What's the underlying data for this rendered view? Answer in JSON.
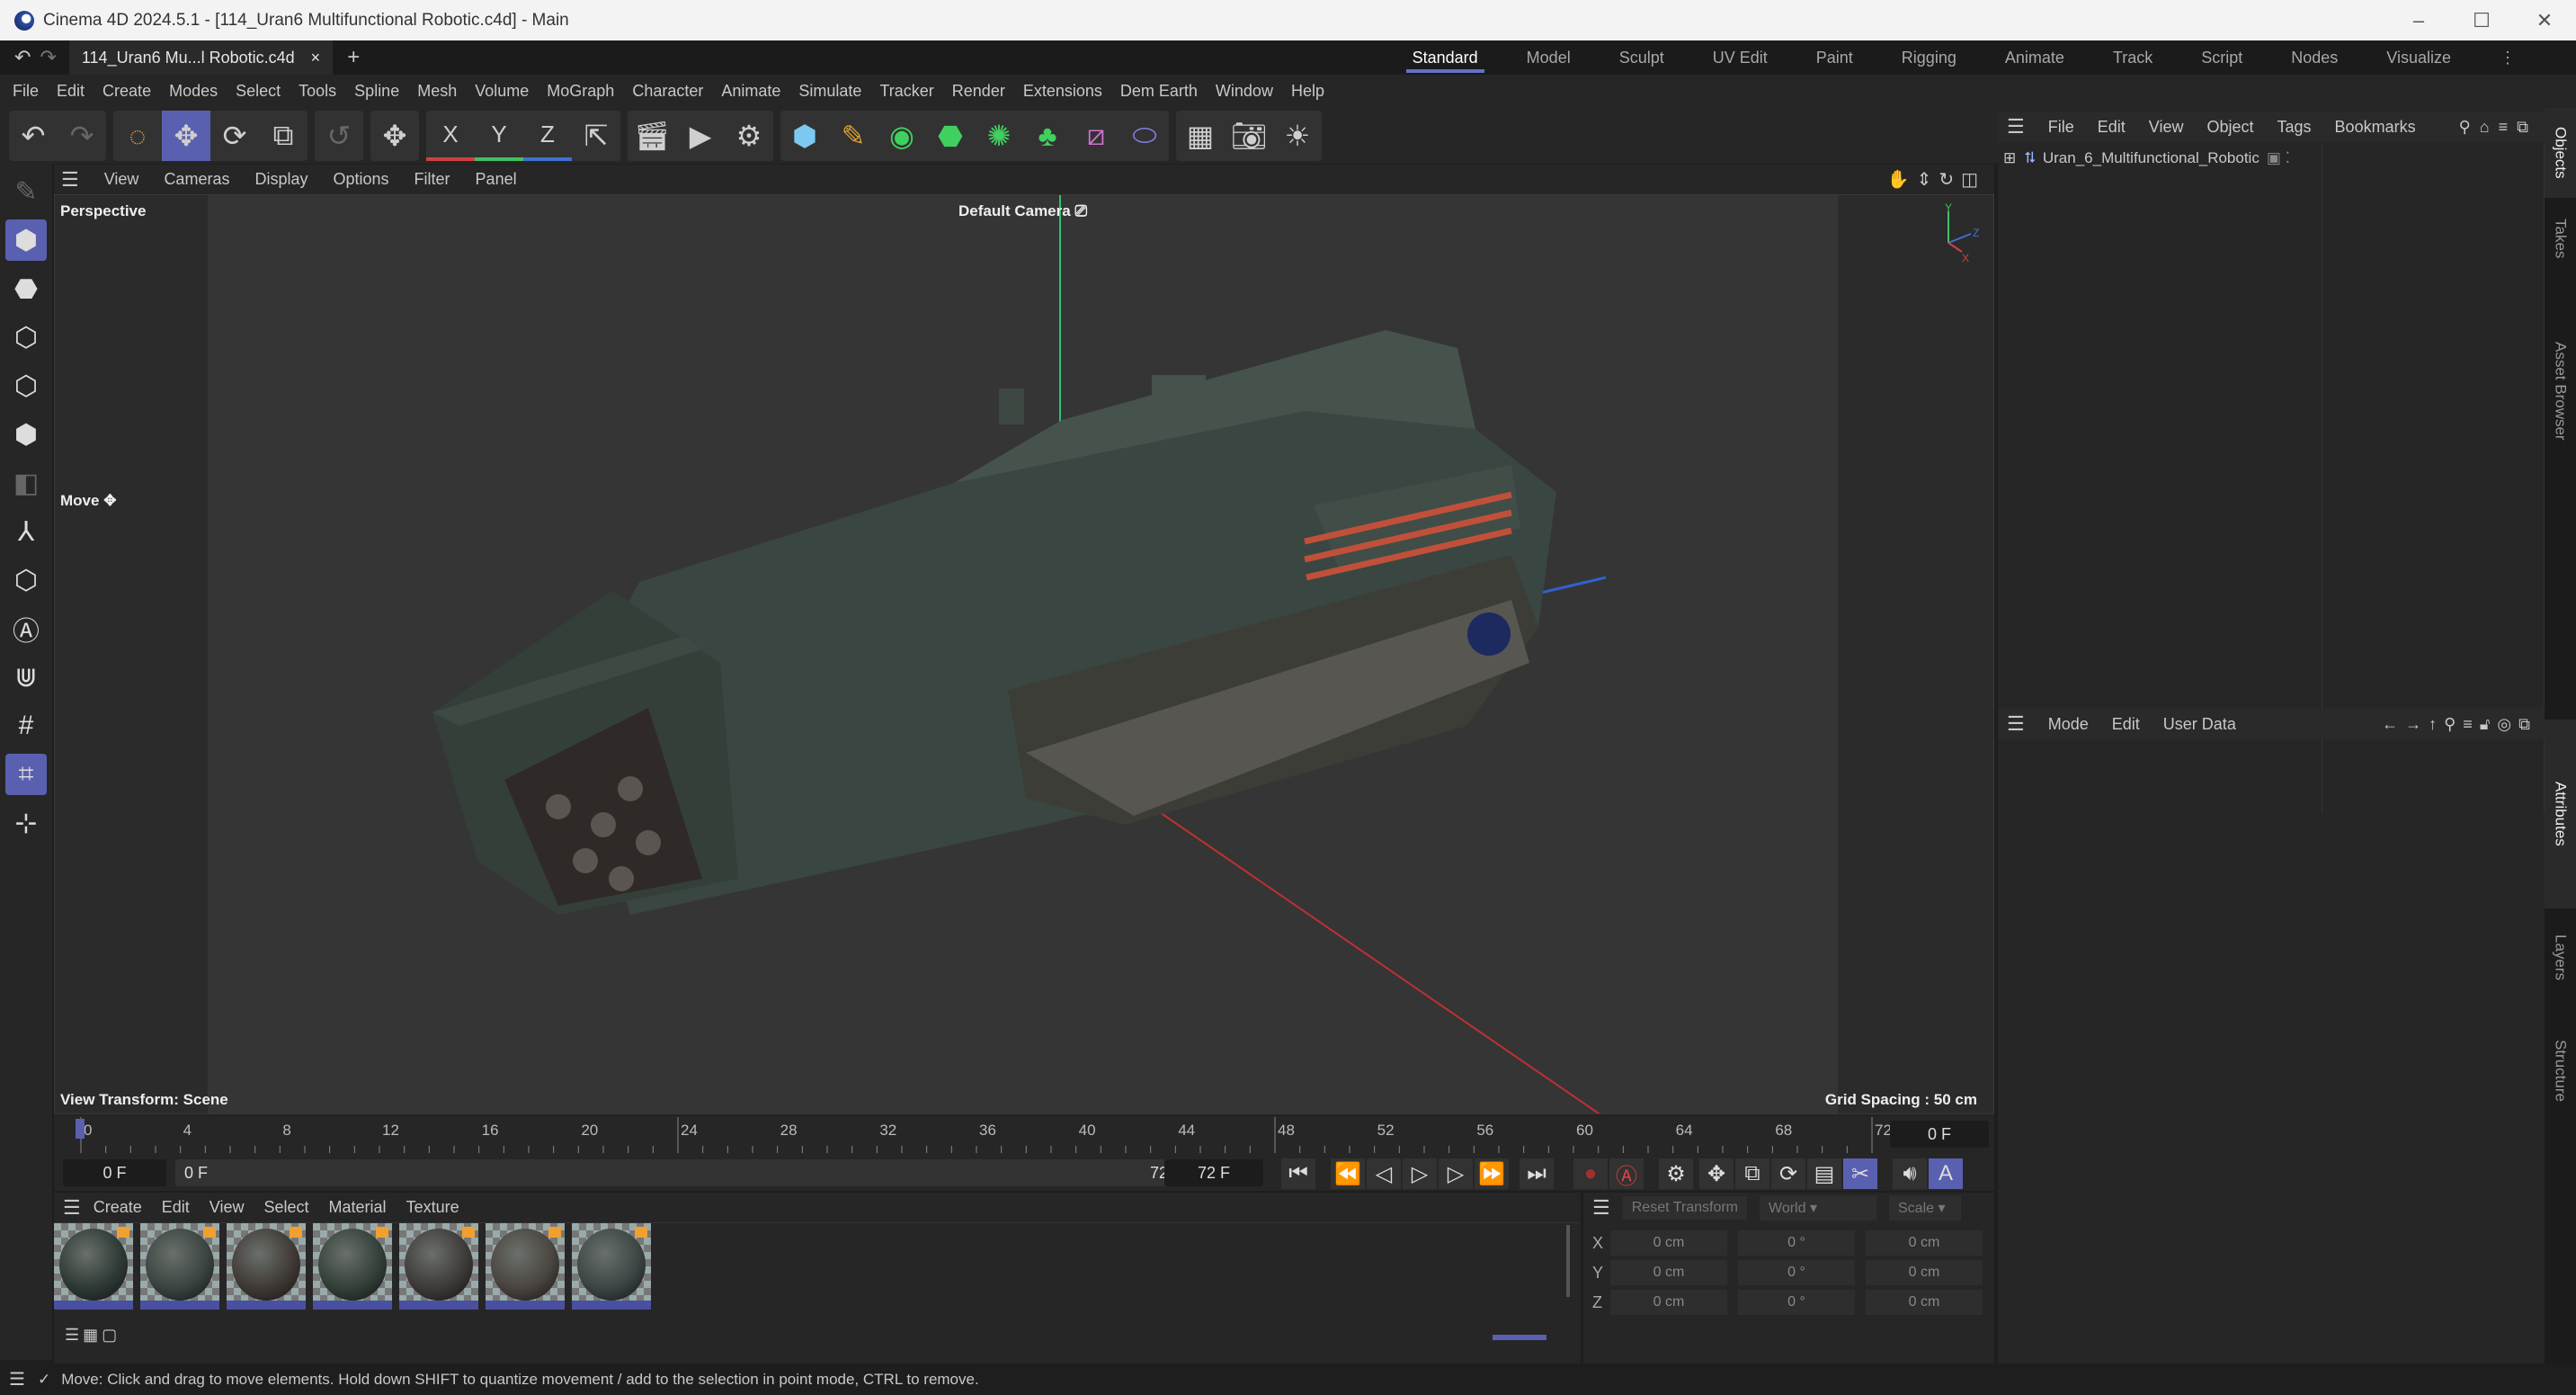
{
  "window": {
    "title": "Cinema 4D 2024.5.1 - [114_Uran6 Multifunctional Robotic.c4d] - Main",
    "minimize": "–",
    "maximize": "☐",
    "close": "✕"
  },
  "tabs": {
    "doc_tab": "114_Uran6 Mu...l Robotic.c4d",
    "close": "×",
    "add": "+",
    "undo": "↶",
    "redo": "↷"
  },
  "layouts": [
    "Standard",
    "Model",
    "Sculpt",
    "UV Edit",
    "Paint",
    "Rigging",
    "Animate",
    "Track",
    "Script",
    "Nodes",
    "Visualize"
  ],
  "layouts_more": "⋮",
  "menu": [
    "File",
    "Edit",
    "Create",
    "Modes",
    "Select",
    "Tools",
    "Spline",
    "Mesh",
    "Volume",
    "MoGraph",
    "Character",
    "Animate",
    "Simulate",
    "Tracker",
    "Render",
    "Extensions",
    "Dem Earth",
    "Window",
    "Help"
  ],
  "toolbar": {
    "x": "X",
    "y": "Y",
    "z": "Z"
  },
  "viewport": {
    "menu": [
      "View",
      "Cameras",
      "Display",
      "Options",
      "Filter",
      "Panel"
    ],
    "projection": "Perspective",
    "camera": "Default Camera",
    "tool": "Move",
    "view_transform": "View Transform: Scene",
    "grid_spacing": "Grid Spacing : 50 cm"
  },
  "objects": {
    "menu": [
      "File",
      "Edit",
      "View",
      "Object",
      "Tags",
      "Bookmarks"
    ],
    "items": [
      "Uran_6_Multifunctional_Robotic"
    ]
  },
  "attributes": {
    "menu": [
      "Mode",
      "Edit",
      "User Data"
    ]
  },
  "side_tabs": [
    "Objects",
    "Takes",
    "Asset Browser",
    "Attributes",
    "Layers",
    "Structure"
  ],
  "timeline": {
    "ticks": [
      0,
      4,
      8,
      12,
      16,
      20,
      24,
      28,
      32,
      36,
      40,
      44,
      48,
      52,
      56,
      60,
      64,
      68,
      72
    ],
    "current_frame": "0 F",
    "start": "0 F",
    "range_start": "0 F",
    "range_end": "72 F",
    "end": "72 F"
  },
  "materials": {
    "menu": [
      "Create",
      "Edit",
      "View",
      "Select",
      "Material",
      "Texture"
    ],
    "count": 7
  },
  "coordinates": {
    "reset": "Reset Transform",
    "space": "World",
    "mode": "Scale",
    "rows": [
      {
        "axis": "X",
        "pos": "0 cm",
        "rot": "0 °",
        "scale": "0 cm"
      },
      {
        "axis": "Y",
        "pos": "0 cm",
        "rot": "0 °",
        "scale": "0 cm"
      },
      {
        "axis": "Z",
        "pos": "0 cm",
        "rot": "0 °",
        "scale": "0 cm"
      }
    ]
  },
  "status": "Move: Click and drag to move elements. Hold down SHIFT to quantize movement / add to the selection in point mode, CTRL to remove.",
  "colors": {
    "accent": "#5a60b0",
    "x_axis": "#d04040",
    "y_axis": "#40c060",
    "z_axis": "#4070d0"
  }
}
